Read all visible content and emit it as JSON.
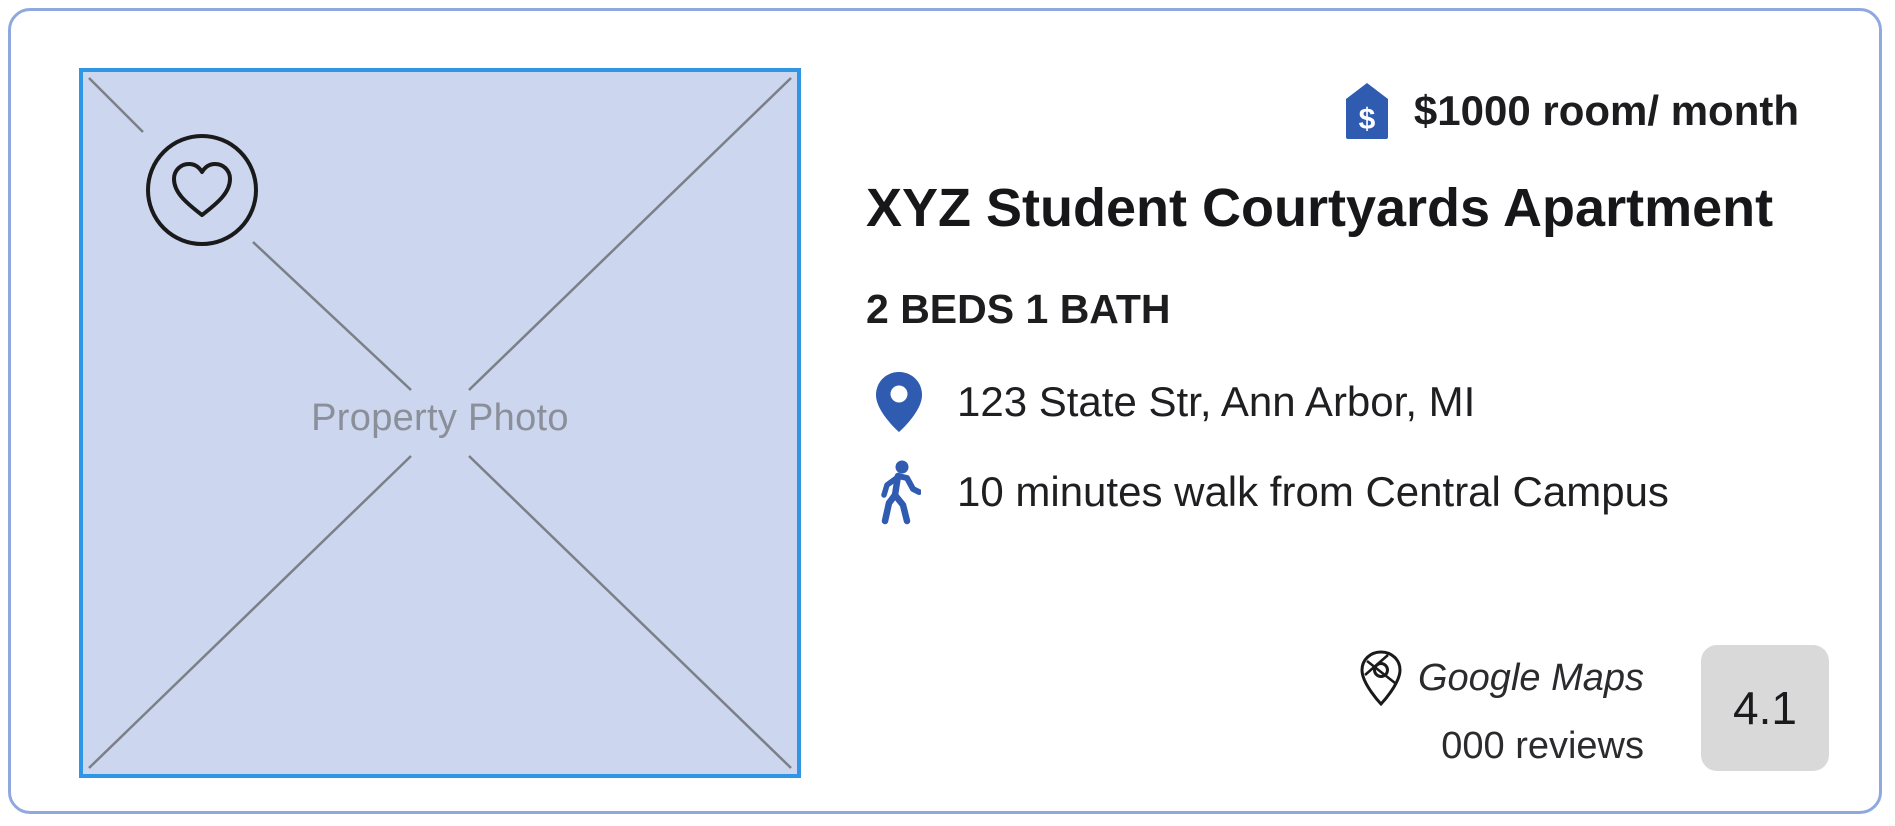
{
  "listing": {
    "photo_label": "Property Photo",
    "price": "$1000 room/ month",
    "title": "XYZ Student Courtyards Apartment",
    "beds_baths": "2 BEDS 1 BATH",
    "address": "123 State Str, Ann Arbor, MI",
    "walk_distance": "10 minutes walk from Central Campus",
    "source": "Google Maps",
    "reviews": "000 reviews",
    "rating": "4.1"
  },
  "icons": {
    "favorite": "heart-icon",
    "price": "dollar-tag-icon",
    "address": "location-pin-icon",
    "walk": "walking-person-icon",
    "source": "map-pin-icon"
  },
  "colors": {
    "accent_blue": "#2f5bb0",
    "card_border": "#8fa9e0",
    "photo_border": "#2e96e4",
    "photo_fill": "#ccd6ee",
    "rating_bg": "#d9d9d9"
  }
}
